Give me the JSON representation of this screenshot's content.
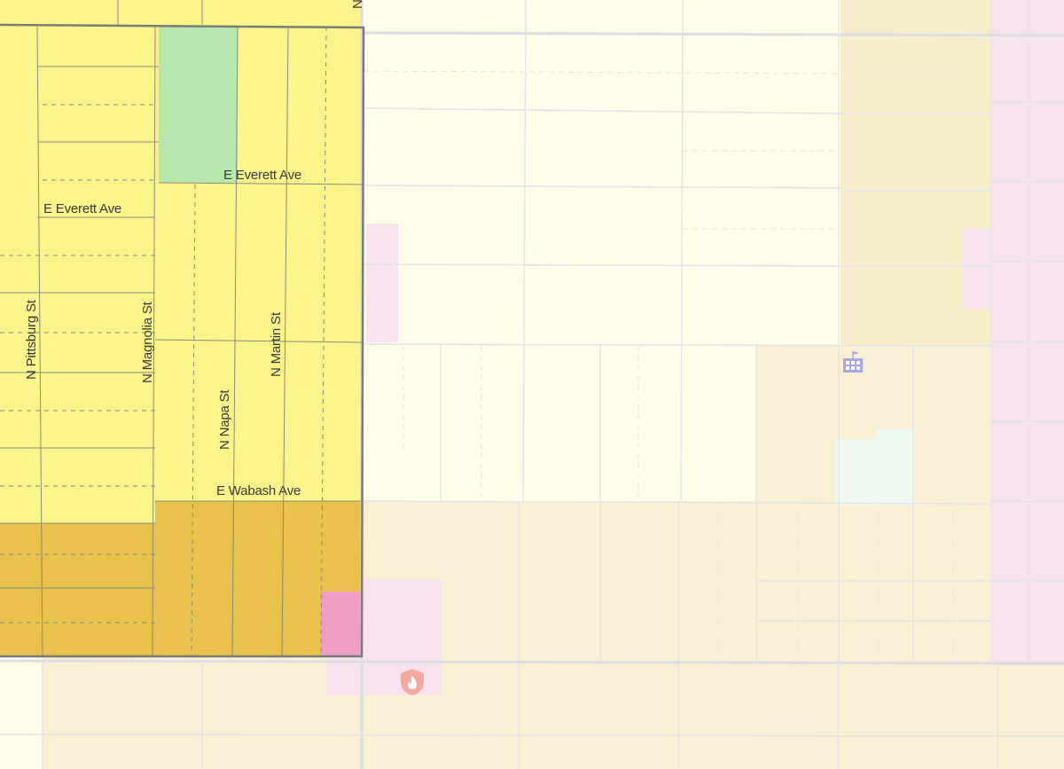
{
  "map": {
    "colors": {
      "frame": "#1f4a5a",
      "zone_yellow": "#faf48a",
      "zone_gold": "#e8c24a",
      "zone_green": "#b6e8ae",
      "zone_pink_dark": "#ef9ec6",
      "zone_pink_light": "#f8e2ef",
      "cream": "#fefde8",
      "tan": "#f9efd3",
      "tan_dark": "#f5e7c2",
      "mint": "#eef8ee",
      "boundary": "#7a7a7a",
      "street": "#dcdde3",
      "school_icon": "#a9a6e8",
      "fire_icon": "#f2aaa0"
    },
    "street_labels": {
      "everett_upper": "E Everett Ave",
      "everett_lower": "E Everett Ave",
      "wabash": "E Wabash Ave",
      "pittsburg": "N Pittsburg St",
      "magnolia": "N Magnolia St",
      "napa": "N Napa St",
      "martin": "N Martin St",
      "top_clip": "N"
    },
    "icons": {
      "school": "school-icon",
      "fire": "fire-station-icon"
    }
  }
}
